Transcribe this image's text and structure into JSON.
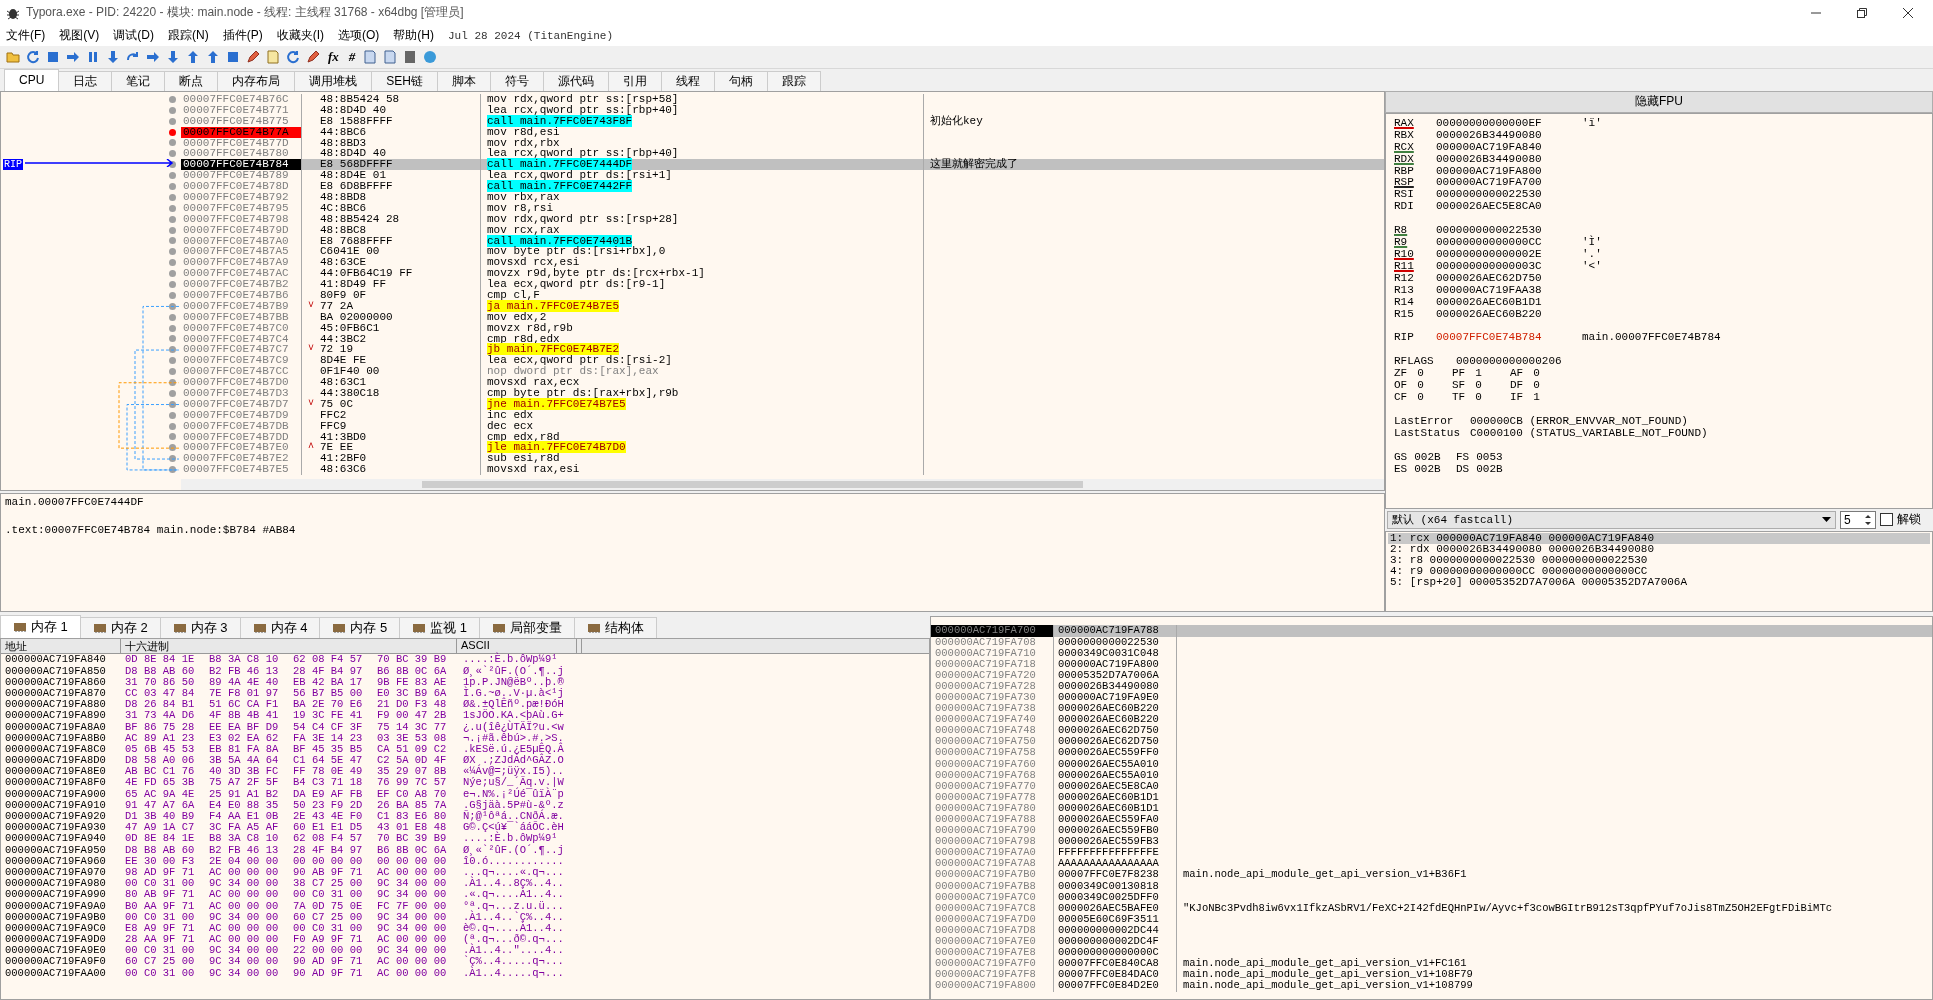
{
  "window": {
    "title": "Typora.exe - PID: 24220 - 模块: main.node - 线程: 主线程 31768 - x64dbg [管理员]"
  },
  "menu": {
    "items": [
      "文件(F)",
      "视图(V)",
      "调试(D)",
      "跟踪(N)",
      "插件(P)",
      "收藏夹(I)",
      "选项(O)",
      "帮助(H)"
    ],
    "build": "Jul 28 2024 (TitanEngine)"
  },
  "toolbar": {
    "text_buttons": [
      "fx",
      "#"
    ]
  },
  "tabs": [
    {
      "label": "CPU",
      "selected": true
    },
    {
      "label": "日志",
      "selected": false
    },
    {
      "label": "笔记",
      "selected": false
    },
    {
      "label": "断点",
      "selected": false
    },
    {
      "label": "内存布局",
      "selected": false
    },
    {
      "label": "调用堆栈",
      "selected": false
    },
    {
      "label": "SEH链",
      "selected": false
    },
    {
      "label": "脚本",
      "selected": false
    },
    {
      "label": "符号",
      "selected": false
    },
    {
      "label": "源代码",
      "selected": false
    },
    {
      "label": "引用",
      "selected": false
    },
    {
      "label": "线程",
      "selected": false
    },
    {
      "label": "句柄",
      "selected": false
    },
    {
      "label": "跟踪",
      "selected": false
    }
  ],
  "disassembly": {
    "rip_label": "RIP",
    "rows": [
      {
        "address": "00007FFC0E74B76C",
        "bytes": "48:8B5424 58",
        "instruction": "mov rdx,qword ptr ss:[rsp+58]",
        "kind": "normal",
        "breakpoint": false,
        "selected": false
      },
      {
        "address": "00007FFC0E74B771",
        "bytes": "48:8D4D 40",
        "instruction": "lea rcx,qword ptr ss:[rbp+40]",
        "kind": "normal",
        "breakpoint": false,
        "selected": false
      },
      {
        "address": "00007FFC0E74B775",
        "bytes": "E8 1588FFFF",
        "instruction": "call main.7FFC0E743F8F",
        "comment": "初始化key",
        "kind": "call",
        "breakpoint": false,
        "selected": false
      },
      {
        "address": "00007FFC0E74B77A",
        "bytes": "44:8BC6",
        "instruction": "mov r8d,esi",
        "kind": "normal",
        "breakpoint": true,
        "selected": false
      },
      {
        "address": "00007FFC0E74B77D",
        "bytes": "48:8BD3",
        "instruction": "mov rdx,rbx",
        "kind": "normal",
        "breakpoint": false,
        "selected": false
      },
      {
        "address": "00007FFC0E74B780",
        "bytes": "48:8D4D 40",
        "instruction": "lea rcx,qword ptr ss:[rbp+40]",
        "kind": "normal",
        "breakpoint": false,
        "selected": false
      },
      {
        "address": "00007FFC0E74B784",
        "bytes": "E8 568DFFFF",
        "instruction": "call main.7FFC0E7444DF",
        "comment": "这里就解密完成了",
        "kind": "call",
        "breakpoint": false,
        "selected": true
      },
      {
        "address": "00007FFC0E74B789",
        "bytes": "48:8D4E 01",
        "instruction": "lea rcx,qword ptr ds:[rsi+1]",
        "kind": "normal",
        "breakpoint": false,
        "selected": false
      },
      {
        "address": "00007FFC0E74B78D",
        "bytes": "E8 6D8BFFFF",
        "instruction": "call main.7FFC0E7442FF",
        "kind": "call",
        "breakpoint": false,
        "selected": false
      },
      {
        "address": "00007FFC0E74B792",
        "bytes": "48:8BD8",
        "instruction": "mov rbx,rax",
        "kind": "normal",
        "breakpoint": false,
        "selected": false
      },
      {
        "address": "00007FFC0E74B795",
        "bytes": "4C:8BC6",
        "instruction": "mov r8,rsi",
        "kind": "normal",
        "breakpoint": false,
        "selected": false
      },
      {
        "address": "00007FFC0E74B798",
        "bytes": "48:8B5424 28",
        "instruction": "mov rdx,qword ptr ss:[rsp+28]",
        "kind": "normal",
        "breakpoint": false,
        "selected": false
      },
      {
        "address": "00007FFC0E74B79D",
        "bytes": "48:8BC8",
        "instruction": "mov rcx,rax",
        "kind": "normal",
        "breakpoint": false,
        "selected": false
      },
      {
        "address": "00007FFC0E74B7A0",
        "bytes": "E8 7688FFFF",
        "instruction": "call main.7FFC0E74401B",
        "kind": "call",
        "breakpoint": false,
        "selected": false
      },
      {
        "address": "00007FFC0E74B7A5",
        "bytes": "C6041E 00",
        "instruction": "mov byte ptr ds:[rsi+rbx],0",
        "kind": "normal",
        "breakpoint": false,
        "selected": false
      },
      {
        "address": "00007FFC0E74B7A9",
        "bytes": "48:63CE",
        "instruction": "movsxd rcx,esi",
        "kind": "normal",
        "breakpoint": false,
        "selected": false
      },
      {
        "address": "00007FFC0E74B7AC",
        "bytes": "44:0FB64C19 FF",
        "instruction": "movzx r9d,byte ptr ds:[rcx+rbx-1]",
        "kind": "normal",
        "breakpoint": false,
        "selected": false
      },
      {
        "address": "00007FFC0E74B7B2",
        "bytes": "41:8D49 FF",
        "instruction": "lea ecx,qword ptr ds:[r9-1]",
        "kind": "normal",
        "breakpoint": false,
        "selected": false
      },
      {
        "address": "00007FFC0E74B7B6",
        "bytes": "80F9 0F",
        "instruction": "cmp cl,F",
        "kind": "normal",
        "breakpoint": false,
        "selected": false
      },
      {
        "address": "00007FFC0E74B7B9",
        "bytes": "77 2A",
        "arrow": "˅",
        "instruction": "ja main.7FFC0E74B7E5",
        "kind": "jump",
        "breakpoint": false,
        "selected": false
      },
      {
        "address": "00007FFC0E74B7BB",
        "bytes": "BA 02000000",
        "instruction": "mov edx,2",
        "kind": "normal",
        "breakpoint": false,
        "selected": false
      },
      {
        "address": "00007FFC0E74B7C0",
        "bytes": "45:0FB6C1",
        "instruction": "movzx r8d,r9b",
        "kind": "normal",
        "breakpoint": false,
        "selected": false
      },
      {
        "address": "00007FFC0E74B7C4",
        "bytes": "44:3BC2",
        "instruction": "cmp r8d,edx",
        "kind": "normal",
        "breakpoint": false,
        "selected": false
      },
      {
        "address": "00007FFC0E74B7C7",
        "bytes": "72 19",
        "arrow": "˅",
        "instruction": "jb main.7FFC0E74B7E2",
        "kind": "jump",
        "breakpoint": false,
        "selected": false
      },
      {
        "address": "00007FFC0E74B7C9",
        "bytes": "8D4E FE",
        "instruction": "lea ecx,qword ptr ds:[rsi-2]",
        "kind": "normal",
        "breakpoint": false,
        "selected": false
      },
      {
        "address": "00007FFC0E74B7CC",
        "bytes": "0F1F40 00",
        "instruction": "nop dword ptr ds:[rax],eax",
        "kind": "nop",
        "breakpoint": false,
        "selected": false
      },
      {
        "address": "00007FFC0E74B7D0",
        "bytes": "48:63C1",
        "instruction": "movsxd rax,ecx",
        "kind": "normal",
        "breakpoint": false,
        "selected": false
      },
      {
        "address": "00007FFC0E74B7D3",
        "bytes": "44:380C18",
        "instruction": "cmp byte ptr ds:[rax+rbx],r9b",
        "kind": "normal",
        "breakpoint": false,
        "selected": false
      },
      {
        "address": "00007FFC0E74B7D7",
        "bytes": "75 0C",
        "arrow": "˅",
        "instruction": "jne main.7FFC0E74B7E5",
        "kind": "jump",
        "breakpoint": false,
        "selected": false
      },
      {
        "address": "00007FFC0E74B7D9",
        "bytes": "FFC2",
        "instruction": "inc edx",
        "kind": "normal",
        "breakpoint": false,
        "selected": false
      },
      {
        "address": "00007FFC0E74B7DB",
        "bytes": "FFC9",
        "instruction": "dec ecx",
        "kind": "normal",
        "breakpoint": false,
        "selected": false
      },
      {
        "address": "00007FFC0E74B7DD",
        "bytes": "41:3BD0",
        "instruction": "cmp edx,r8d",
        "kind": "normal",
        "breakpoint": false,
        "selected": false
      },
      {
        "address": "00007FFC0E74B7E0",
        "bytes": "7E EE",
        "arrow": "˄",
        "instruction": "jle main.7FFC0E74B7D0",
        "kind": "jump",
        "breakpoint": false,
        "selected": false
      },
      {
        "address": "00007FFC0E74B7E2",
        "bytes": "41:2BF0",
        "instruction": "sub esi,r8d",
        "kind": "normal",
        "breakpoint": false,
        "selected": false
      },
      {
        "address": "00007FFC0E74B7E5",
        "bytes": "48:63C6",
        "instruction": "movsxd rax,esi",
        "kind": "normal",
        "breakpoint": false,
        "selected": false
      }
    ]
  },
  "info": {
    "symbol": "main.00007FFC0E7444DF",
    "location": ".text:00007FFC0E74B784 main.node:$B784 #AB84"
  },
  "registers": {
    "toggle_button": "隐藏FPU",
    "groups": [
      [
        {
          "name": "RAX",
          "value": "00000000000000EF",
          "comment": "'ï'",
          "color": "#d00000",
          "changed": false
        },
        {
          "name": "RBX",
          "value": "0000026B34490080",
          "changed": false
        },
        {
          "name": "RCX",
          "value": "000000AC719FA840",
          "color": "#408040",
          "changed": false
        },
        {
          "name": "RDX",
          "value": "0000026B34490080",
          "color": "#408040",
          "changed": false
        },
        {
          "name": "RBP",
          "value": "000000AC719FA800",
          "changed": false
        },
        {
          "name": "RSP",
          "value": "000000AC719FA700",
          "color": "#202020",
          "changed": false
        },
        {
          "name": "RSI",
          "value": "0000000000022530",
          "changed": false
        },
        {
          "name": "RDI",
          "value": "0000026AEC5E8CA0",
          "changed": false
        }
      ],
      [
        {
          "name": "R8",
          "value": "0000000000022530",
          "color": "#408040",
          "changed": false
        },
        {
          "name": "R9",
          "value": "00000000000000CC",
          "comment": "'Ì'",
          "color": "#408040",
          "changed": false
        },
        {
          "name": "R10",
          "value": "000000000000002E",
          "comment": "'.'",
          "color": "#d00000",
          "changed": false
        },
        {
          "name": "R11",
          "value": "000000000000003C",
          "comment": "'<'",
          "color": "#d00000",
          "changed": false
        },
        {
          "name": "R12",
          "value": "0000026AEC62D750",
          "changed": false
        },
        {
          "name": "R13",
          "value": "000000AC719FAA38",
          "changed": false
        },
        {
          "name": "R14",
          "value": "0000026AEC60B1D1",
          "changed": false
        },
        {
          "name": "R15",
          "value": "0000026AEC60B220",
          "changed": false
        }
      ],
      [
        {
          "name": "RIP",
          "value": "00007FFC0E74B784",
          "comment": "main.00007FFC0E74B784",
          "changed": true
        }
      ]
    ],
    "rflags": {
      "name": "RFLAGS",
      "value": "0000000000000206"
    },
    "flags": [
      [
        {
          "name": "ZF",
          "value": "0"
        },
        {
          "name": "PF",
          "value": "1"
        },
        {
          "name": "AF",
          "value": "0"
        }
      ],
      [
        {
          "name": "OF",
          "value": "0"
        },
        {
          "name": "SF",
          "value": "0"
        },
        {
          "name": "DF",
          "value": "0"
        }
      ],
      [
        {
          "name": "CF",
          "value": "0"
        },
        {
          "name": "TF",
          "value": "0"
        },
        {
          "name": "IF",
          "value": "1"
        }
      ]
    ],
    "errors": [
      {
        "name": "LastError",
        "value": "000000CB (ERROR_ENVVAR_NOT_FOUND)"
      },
      {
        "name": "LastStatus",
        "value": "C0000100 (STATUS_VARIABLE_NOT_FOUND)"
      }
    ],
    "segments": [
      [
        {
          "name": "GS",
          "value": "002B"
        },
        {
          "name": "FS",
          "value": "0053"
        }
      ],
      [
        {
          "name": "ES",
          "value": "002B"
        },
        {
          "name": "DS",
          "value": "002B"
        }
      ]
    ]
  },
  "call_convention": {
    "value": "默认 (x64 fastcall)",
    "count": "5",
    "unlock_label": "解锁",
    "unlock_checked": false
  },
  "arguments": [
    {
      "text": "1: rcx 000000AC719FA840 000000AC719FA840",
      "selected": true
    },
    {
      "text": "2: rdx 0000026B34490080 0000026B34490080",
      "selected": false
    },
    {
      "text": "3: r8 0000000000022530 0000000000022530",
      "selected": false
    },
    {
      "text": "4: r9 00000000000000CC 00000000000000CC",
      "selected": false
    },
    {
      "text": "5: [rsp+20] 00005352D7A7006A 00005352D7A7006A",
      "selected": false
    }
  ],
  "bottom_tabs": [
    {
      "label": "内存 1",
      "selected": true
    },
    {
      "label": "内存 2",
      "selected": false
    },
    {
      "label": "内存 3",
      "selected": false
    },
    {
      "label": "内存 4",
      "selected": false
    },
    {
      "label": "内存 5",
      "selected": false
    },
    {
      "label": "监视 1",
      "selected": false
    },
    {
      "label": "局部变量",
      "selected": false
    },
    {
      "label": "结构体",
      "selected": false
    }
  ],
  "dump": {
    "columns": [
      "地址",
      "十六进制",
      "ASCII"
    ],
    "rows": [
      {
        "address": "000000AC719FA840",
        "hex": [
          "0D 8E 84 1E",
          "B8 3A C8 10",
          "62 08 F4 57",
          "70 BC 39 B9"
        ],
        "ascii": "....:È.b.ôWp¼9¹"
      },
      {
        "address": "000000AC719FA850",
        "hex": [
          "D8 B8 AB 60",
          "B2 FB 46 13",
          "28 4F B4 97",
          "B6 8B 0C 6A"
        ],
        "ascii": "Ø¸«`²ûF.(O´.¶..j"
      },
      {
        "address": "000000AC719FA860",
        "hex": [
          "31 70 86 50",
          "89 4A 4E 40",
          "EB 42 BA 17",
          "9B FE 83 AE"
        ],
        "ascii": "1p.P.JN@ëBº..þ.®"
      },
      {
        "address": "000000AC719FA870",
        "hex": [
          "CC 03 47 84",
          "7E F8 01 97",
          "56 B7 B5 00",
          "E0 3C B9 6A"
        ],
        "ascii": "Ì.G.~ø..V·µ.à<¹j"
      },
      {
        "address": "000000AC719FA880",
        "hex": [
          "D8 26 84 B1",
          "51 6C CA F1",
          "BA 2E 70 E6",
          "21 D0 F3 48"
        ],
        "ascii": "Ø&.±QlÊñº.pæ!ÐóH"
      },
      {
        "address": "000000AC719FA890",
        "hex": [
          "31 73 4A D6",
          "4F 8B 4B 41",
          "19 3C FE 41",
          "F9 00 47 2B"
        ],
        "ascii": "1sJÖO.KA.<þAù.G+"
      },
      {
        "address": "000000AC719FA8A0",
        "hex": [
          "BF 86 75 28",
          "EE EA BF D9",
          "54 C4 CF 3F",
          "75 14 3C 77"
        ],
        "ascii": "¿.u(îê¿ÙTÄÏ?u.<w"
      },
      {
        "address": "000000AC719FA8B0",
        "hex": [
          "AC 89 A1 23",
          "E3 02 EA 62",
          "FA 3E 14 23",
          "03 3E 53 08"
        ],
        "ascii": "¬.¡#ã.êbú>.#.>S."
      },
      {
        "address": "000000AC719FA8C0",
        "hex": [
          "05 6B 45 53",
          "EB 81 FA 8A",
          "BF 45 35 B5",
          "CA 51 09 C2"
        ],
        "ascii": ".kESë.ú.¿E5µÊQ.Â"
      },
      {
        "address": "000000AC719FA8D0",
        "hex": [
          "D8 58 A0 06",
          "3B 5A 4A 64",
          "C1 64 5E 47",
          "C2 5A 0D 4F"
        ],
        "ascii": "ØX .;ZJdÁd^GÂZ.O"
      },
      {
        "address": "000000AC719FA8E0",
        "hex": [
          "AB BC C1 76",
          "40 3D 3B FC",
          "FF 78 0E 49",
          "35 29 07 8B"
        ],
        "ascii": "«¼Áv@=;üÿx.I5).."
      },
      {
        "address": "000000AC719FA8F0",
        "hex": [
          "4E FD 65 3B",
          "75 A7 2F 5F",
          "B4 C3 71 18",
          "76 99 7C 57"
        ],
        "ascii": "Nýe;u§/_´Ãq.v.|W"
      },
      {
        "address": "000000AC719FA900",
        "hex": [
          "65 AC 9A 4E",
          "25 91 A1 B2",
          "DA E9 AF FB",
          "EF C0 A8 70"
        ],
        "ascii": "e¬.N%.¡²Úé¯ûïÀ¨p"
      },
      {
        "address": "000000AC719FA910",
        "hex": [
          "91 47 A7 6A",
          "E4 E0 88 35",
          "50 23 F9 2D",
          "26 BA 85 7A"
        ],
        "ascii": ".G§jäà.5P#ù-&º.z"
      },
      {
        "address": "000000AC719FA920",
        "hex": [
          "D1 3B 40 B9",
          "F4 AA E1 0B",
          "2E 43 4E F0",
          "C1 83 E6 80"
        ],
        "ascii": "Ñ;@¹ôªá..CNðÁ.æ."
      },
      {
        "address": "000000AC719FA930",
        "hex": [
          "47 A9 1A C7",
          "3C FA A5 AF",
          "60 E1 E1 D5",
          "43 01 E8 48"
        ],
        "ascii": "G©.Ç<ú¥¯`ááÕC.èH"
      },
      {
        "address": "000000AC719FA940",
        "hex": [
          "0D 8E 84 1E",
          "B8 3A C8 10",
          "62 08 F4 57",
          "70 BC 39 B9"
        ],
        "ascii": "....:È.b.ôWp¼9¹"
      },
      {
        "address": "000000AC719FA950",
        "hex": [
          "D8 B8 AB 60",
          "B2 FB 46 13",
          "28 4F B4 97",
          "B6 8B 0C 6A"
        ],
        "ascii": "Ø¸«`²ûF.(O´.¶..j"
      },
      {
        "address": "000000AC719FA960",
        "hex": [
          "EE 30 00 F3",
          "2E 04 00 00",
          "00 00 00 00",
          "00 00 00 00"
        ],
        "ascii": "î0.ó............"
      },
      {
        "address": "000000AC719FA970",
        "hex": [
          "98 AD 9F 71",
          "AC 00 00 00",
          "90 AB 9F 71",
          "AC 00 00 00"
        ],
        "ascii": "...q¬....«.q¬..."
      },
      {
        "address": "000000AC719FA980",
        "hex": [
          "00 C0 31 00",
          "9C 34 00 00",
          "38 C7 25 00",
          "9C 34 00 00"
        ],
        "ascii": ".À1..4..8Ç%..4.."
      },
      {
        "address": "000000AC719FA990",
        "hex": [
          "80 AB 9F 71",
          "AC 00 00 00",
          "00 C0 31 00",
          "9C 34 00 00"
        ],
        "ascii": ".«.q¬....À1..4.."
      },
      {
        "address": "000000AC719FA9A0",
        "hex": [
          "B0 AA 9F 71",
          "AC 00 00 00",
          "7A 0D 75 0E",
          "FC 7F 00 00"
        ],
        "ascii": "°ª.q¬...z.u.ü..."
      },
      {
        "address": "000000AC719FA9B0",
        "hex": [
          "00 C0 31 00",
          "9C 34 00 00",
          "60 C7 25 00",
          "9C 34 00 00"
        ],
        "ascii": ".À1..4..`Ç%..4.."
      },
      {
        "address": "000000AC719FA9C0",
        "hex": [
          "E8 A9 9F 71",
          "AC 00 00 00",
          "00 C0 31 00",
          "9C 34 00 00"
        ],
        "ascii": "è©.q¬....À1..4.."
      },
      {
        "address": "000000AC719FA9D0",
        "hex": [
          "28 AA 9F 71",
          "AC 00 00 00",
          "F0 A9 9F 71",
          "AC 00 00 00"
        ],
        "ascii": "(ª.q¬...ð©.q¬..."
      },
      {
        "address": "000000AC719FA9E0",
        "hex": [
          "00 C0 31 00",
          "9C 34 00 00",
          "22 00 00 00",
          "9C 34 00 00"
        ],
        "ascii": ".À1..4..\"....4.."
      },
      {
        "address": "000000AC719FA9F0",
        "hex": [
          "60 C7 25 00",
          "9C 34 00 00",
          "90 AD 9F 71",
          "AC 00 00 00"
        ],
        "ascii": "`Ç%..4.....q¬..."
      },
      {
        "address": "000000AC719FAA00",
        "hex": [
          "00 C0 31 00",
          "9C 34 00 00",
          "90 AD 9F 71",
          "AC 00 00 00"
        ],
        "ascii": ".À1..4.....q¬..."
      }
    ]
  },
  "stack": {
    "rows": [
      {
        "address": "000000AC719FA700",
        "value": "000000AC719FA788",
        "selected": true
      },
      {
        "address": "000000AC719FA708",
        "value": "0000000000022530",
        "selected": false
      },
      {
        "address": "000000AC719FA710",
        "value": "0000349C0031C048",
        "selected": false
      },
      {
        "address": "000000AC719FA718",
        "value": "000000AC719FA800",
        "selected": false
      },
      {
        "address": "000000AC719FA720",
        "value": "00005352D7A7006A",
        "selected": false
      },
      {
        "address": "000000AC719FA728",
        "value": "0000026B34490080",
        "selected": false
      },
      {
        "address": "000000AC719FA730",
        "value": "000000AC719FA9E0",
        "selected": false
      },
      {
        "address": "000000AC719FA738",
        "value": "0000026AEC60B220",
        "selected": false
      },
      {
        "address": "000000AC719FA740",
        "value": "0000026AEC60B220",
        "selected": false
      },
      {
        "address": "000000AC719FA748",
        "value": "0000026AEC62D750",
        "selected": false
      },
      {
        "address": "000000AC719FA750",
        "value": "0000026AEC62D750",
        "selected": false
      },
      {
        "address": "000000AC719FA758",
        "value": "0000026AEC559FF0",
        "selected": false
      },
      {
        "address": "000000AC719FA760",
        "value": "0000026AEC55A010",
        "selected": false
      },
      {
        "address": "000000AC719FA768",
        "value": "0000026AEC55A010",
        "selected": false
      },
      {
        "address": "000000AC719FA770",
        "value": "0000026AEC5E8CA0",
        "selected": false
      },
      {
        "address": "000000AC719FA778",
        "value": "0000026AEC60B1D1",
        "selected": false
      },
      {
        "address": "000000AC719FA780",
        "value": "0000026AEC60B1D1",
        "selected": false
      },
      {
        "address": "000000AC719FA788",
        "value": "0000026AEC559FA0",
        "selected": false
      },
      {
        "address": "000000AC719FA790",
        "value": "0000026AEC559FB0",
        "selected": false
      },
      {
        "address": "000000AC719FA798",
        "value": "0000026AEC559FB3",
        "selected": false
      },
      {
        "address": "000000AC719FA7A0",
        "value": "FFFFFFFFFFFFFFFE",
        "selected": false
      },
      {
        "address": "000000AC719FA7A8",
        "value": "AAAAAAAAAAAAAAAA",
        "selected": false
      },
      {
        "address": "000000AC719FA7B0",
        "value": "00007FFC0E7F8238",
        "comment": "main.node_api_module_get_api_version_v1+B36F1",
        "selected": false
      },
      {
        "address": "000000AC719FA7B8",
        "value": "0000349C00130818",
        "selected": false
      },
      {
        "address": "000000AC719FA7C0",
        "value": "0000349C0025DFF0",
        "selected": false
      },
      {
        "address": "000000AC719FA7C8",
        "value": "0000026AEC5BAFE0",
        "comment": "\"KJoNBc3Pvdh8iw6vx1IfkzASbRV1/FeXC+2I42fdEQHnPIw/Ayvc+f3cowBGItrB912sT3qpfPYuf7oJis8TmZ5OH2EFgtFDiBiMTc",
        "selected": false
      },
      {
        "address": "000000AC719FA7D0",
        "value": "00005E60C69F3511",
        "selected": false
      },
      {
        "address": "000000AC719FA7D8",
        "value": "000000000002DC44",
        "selected": false
      },
      {
        "address": "000000AC719FA7E0",
        "value": "000000000002DC4F",
        "selected": false
      },
      {
        "address": "000000AC719FA7E8",
        "value": "000000000000000C",
        "selected": false
      },
      {
        "address": "000000AC719FA7F0",
        "value": "00007FFC0E840CA8",
        "comment": "main.node_api_module_get_api_version_v1+FC161",
        "selected": false
      },
      {
        "address": "000000AC719FA7F8",
        "value": "00007FFC0E84DAC0",
        "comment": "main.node_api_module_get_api_version_v1+108F79",
        "selected": false
      },
      {
        "address": "000000AC719FA800",
        "value": "00007FFC0E84D2E0",
        "comment": "main.node_api_module_get_api_version_v1+108799",
        "selected": false
      }
    ]
  }
}
